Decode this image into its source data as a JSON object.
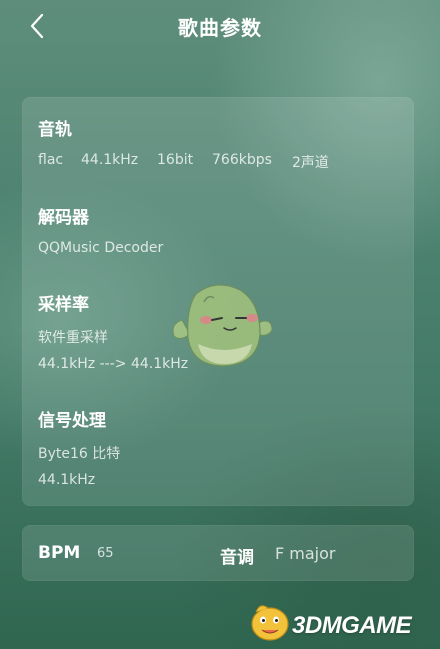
{
  "header": {
    "title": "歌曲参数",
    "back_icon": "chevron-left-icon"
  },
  "track": {
    "title": "音轨",
    "format": "flac",
    "sample_rate": "44.1kHz",
    "bit_depth": "16bit",
    "bitrate": "766kbps",
    "channels": "2声道"
  },
  "decoder": {
    "title": "解码器",
    "value": "QQMusic Decoder"
  },
  "sampling": {
    "title": "采样率",
    "mode": "软件重采样",
    "conversion": "44.1kHz ---> 44.1kHz"
  },
  "signal": {
    "title": "信号处理",
    "processor": "Byte16 比特",
    "rate": "44.1kHz"
  },
  "bpm": {
    "label": "BPM",
    "value": "65"
  },
  "key": {
    "label": "音调",
    "value": "F major"
  },
  "watermark": {
    "text": "3DMGAME"
  },
  "colors": {
    "background_top": "#5e8d7b",
    "background_bottom": "#2f6650",
    "card": "rgba(255,255,255,0.12)",
    "mascot_green": "#9fbf7a",
    "mascot_pink": "#e88a8a",
    "logo_yellow": "#f2c23a"
  }
}
